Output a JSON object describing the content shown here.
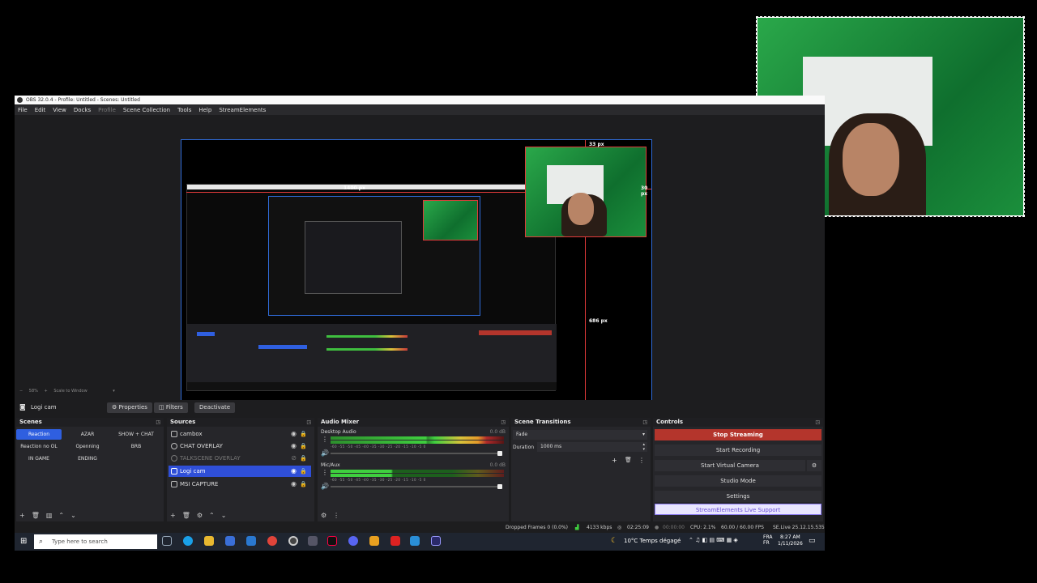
{
  "window": {
    "title": "OBS 32.0.4 - Profile: Untitled - Scenes: Untitled"
  },
  "menu": [
    "File",
    "Edit",
    "View",
    "Docks",
    "Profile",
    "Scene Collection",
    "Tools",
    "Help",
    "StreamElements"
  ],
  "preview": {
    "width_label": "1400 px",
    "top_label": "33 px",
    "side_label": "30 px",
    "bottom_label": "686 px"
  },
  "zoom": {
    "level": "58%",
    "scale_label": "Scale to Window"
  },
  "source_toolbar": {
    "source_name": "Logi cam",
    "properties": "Properties",
    "filters": "Filters",
    "deactivate": "Deactivate"
  },
  "scenes": {
    "title": "Scenes",
    "items": [
      {
        "label": "Reaction",
        "active": true
      },
      {
        "label": "AZAR"
      },
      {
        "label": "SHOW + CHAT"
      },
      {
        "label": "Reaction no OL"
      },
      {
        "label": "Openning"
      },
      {
        "label": "BRB"
      },
      {
        "label": "IN GAME"
      },
      {
        "label": "ENDING"
      }
    ]
  },
  "sources": {
    "title": "Sources",
    "items": [
      {
        "label": "cambox"
      },
      {
        "label": "CHAT OVERLAY"
      },
      {
        "label": "TALKSCENE OVERLAY",
        "hidden": true
      },
      {
        "label": "Logi cam",
        "selected": true
      },
      {
        "label": "MSI CAPTURE"
      }
    ]
  },
  "mixer": {
    "title": "Audio Mixer",
    "channels": [
      {
        "name": "Desktop Audio",
        "db": "0.0 dB"
      },
      {
        "name": "Mic/Aux",
        "db": "0.0 dB"
      }
    ],
    "ticks": "-60 -55 -50 -45 -40 -35 -30 -25 -20 -15 -10 -5 0"
  },
  "transitions": {
    "title": "Scene Transitions",
    "selected": "Fade",
    "duration_label": "Duration",
    "duration_value": "1000 ms"
  },
  "controls": {
    "title": "Controls",
    "stop_streaming": "Stop Streaming",
    "start_recording": "Start Recording",
    "start_virtual_camera": "Start Virtual Camera",
    "studio_mode": "Studio Mode",
    "settings": "Settings",
    "support": "StreamElements Live Support"
  },
  "status": {
    "dropped_frames": "Dropped Frames 0 (0.0%)",
    "bitrate": "4133 kbps",
    "stream_time": "02:25:09",
    "rec_time": "00:00:00",
    "cpu": "CPU: 2.1%",
    "fps": "60.00 / 60.00 FPS",
    "version": "SE.Live 25.12.15.535"
  },
  "taskbar": {
    "search_placeholder": "Type here to search",
    "weather": "10°C  Temps dégagé",
    "lang": "FRA",
    "lang2": "FR",
    "time": "8:27 AM",
    "date": "1/11/2026"
  },
  "colors": {
    "accent": "#2f5fe0",
    "stop": "#b4352c",
    "selection": "#e23a3a",
    "greenscreen": "#1b8f3c"
  }
}
